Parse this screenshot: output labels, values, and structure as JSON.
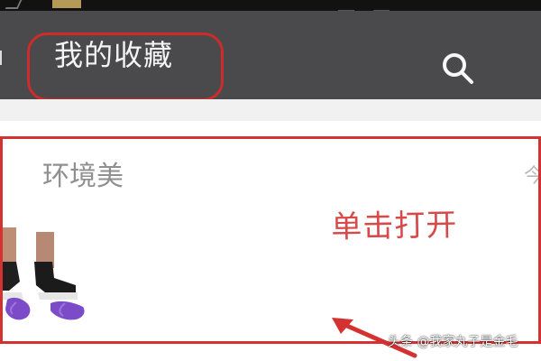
{
  "header": {
    "title": "我的收藏",
    "search_icon": "search-icon",
    "background_color": "#4a4a4c"
  },
  "list": {
    "items": [
      {
        "title": "环境美",
        "meta": "今",
        "thumbnail_icon": "shoe-image"
      }
    ]
  },
  "annotation": {
    "text": "单击打开",
    "color": "#d43131"
  },
  "watermark": {
    "text": "头条 @我家丸子是金毛"
  }
}
